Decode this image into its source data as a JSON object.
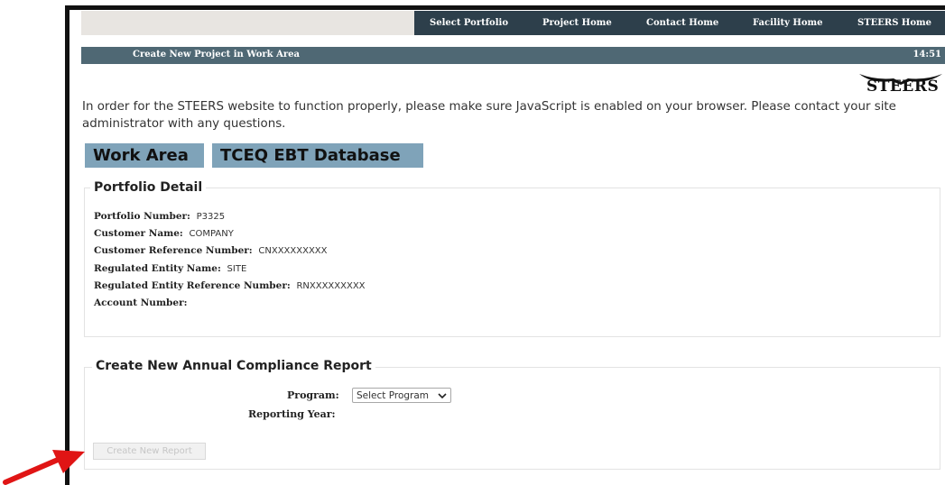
{
  "nav": {
    "items": [
      "Select Portfolio",
      "Project Home",
      "Contact Home",
      "Facility Home",
      "STEERS Home"
    ]
  },
  "titlebar": {
    "title": "Create New Project in Work Area",
    "time": "14:51"
  },
  "logo": {
    "text": "STEERS"
  },
  "js_message": "In order for the STEERS website to function properly, please make sure JavaScript is enabled on your browser. Please contact your site administrator with any questions.",
  "tabs": [
    "Work Area",
    "TCEQ EBT Database"
  ],
  "portfolio": {
    "legend": "Portfolio Detail",
    "rows": [
      {
        "label": "Portfolio Number:",
        "value": "P3325"
      },
      {
        "label": "Customer Name:",
        "value": "COMPANY"
      },
      {
        "label": "Customer Reference Number:",
        "value": "CNXXXXXXXXX"
      },
      {
        "label": "Regulated Entity Name:",
        "value": "SITE"
      },
      {
        "label": "Regulated Entity Reference Number:",
        "value": "RNXXXXXXXXX"
      },
      {
        "label": "Account Number:",
        "value": ""
      }
    ]
  },
  "report": {
    "legend": "Create New Annual Compliance Report",
    "program_label": "Program:",
    "program_value": "Select Program",
    "year_label": "Reporting Year:",
    "button": "Create New Report"
  },
  "colors": {
    "nav_bg": "#2d3f4b",
    "titlebar_bg": "#4f6874",
    "tab_bg": "#7fa3b9",
    "arrow": "#e01515"
  }
}
